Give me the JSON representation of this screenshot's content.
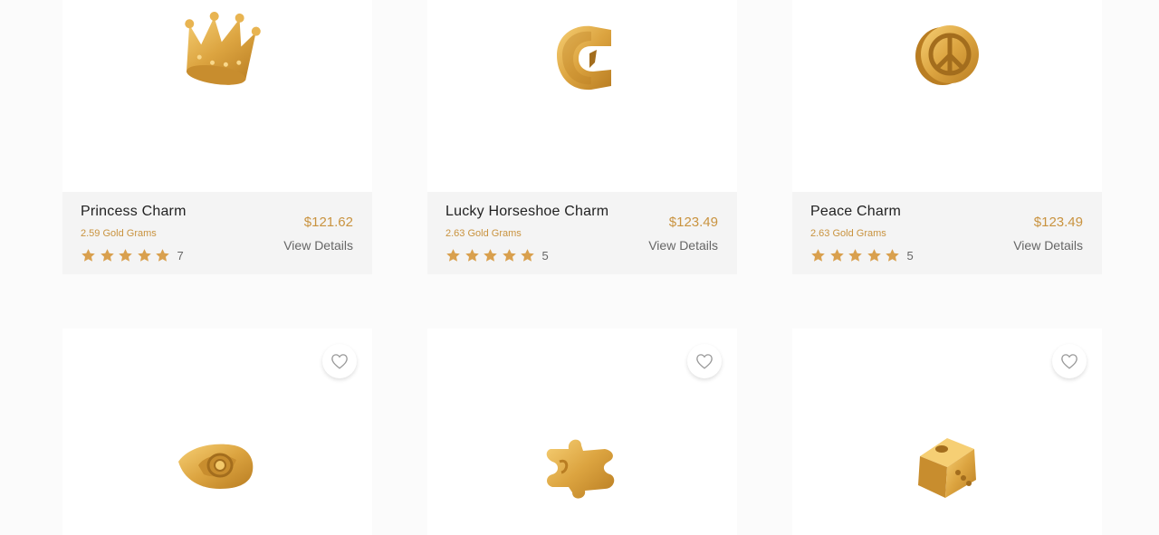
{
  "products": [
    {
      "name": "Princess Charm",
      "weight": "2.59 Gold Grams",
      "price": "$121.62",
      "details_label": "View Details",
      "rating_count": "7",
      "image_icon": "crown-charm-icon"
    },
    {
      "name": "Lucky Horseshoe Charm",
      "weight": "2.63 Gold Grams",
      "price": "$123.49",
      "details_label": "View Details",
      "rating_count": "5",
      "image_icon": "horseshoe-charm-icon"
    },
    {
      "name": "Peace Charm",
      "weight": "2.63 Gold Grams",
      "price": "$123.49",
      "details_label": "View Details",
      "rating_count": "5",
      "image_icon": "peace-charm-icon"
    },
    {
      "image_icon": "evil-eye-charm-icon",
      "wishlist_icon": "heart-icon"
    },
    {
      "image_icon": "puzzle-charm-icon",
      "wishlist_icon": "heart-icon"
    },
    {
      "image_icon": "dice-charm-icon",
      "wishlist_icon": "heart-icon"
    }
  ],
  "colors": {
    "gold": "#c9933f",
    "star": "#d9a04e",
    "info_bg": "#f4f4f4",
    "text": "#222222",
    "muted": "#666666"
  }
}
